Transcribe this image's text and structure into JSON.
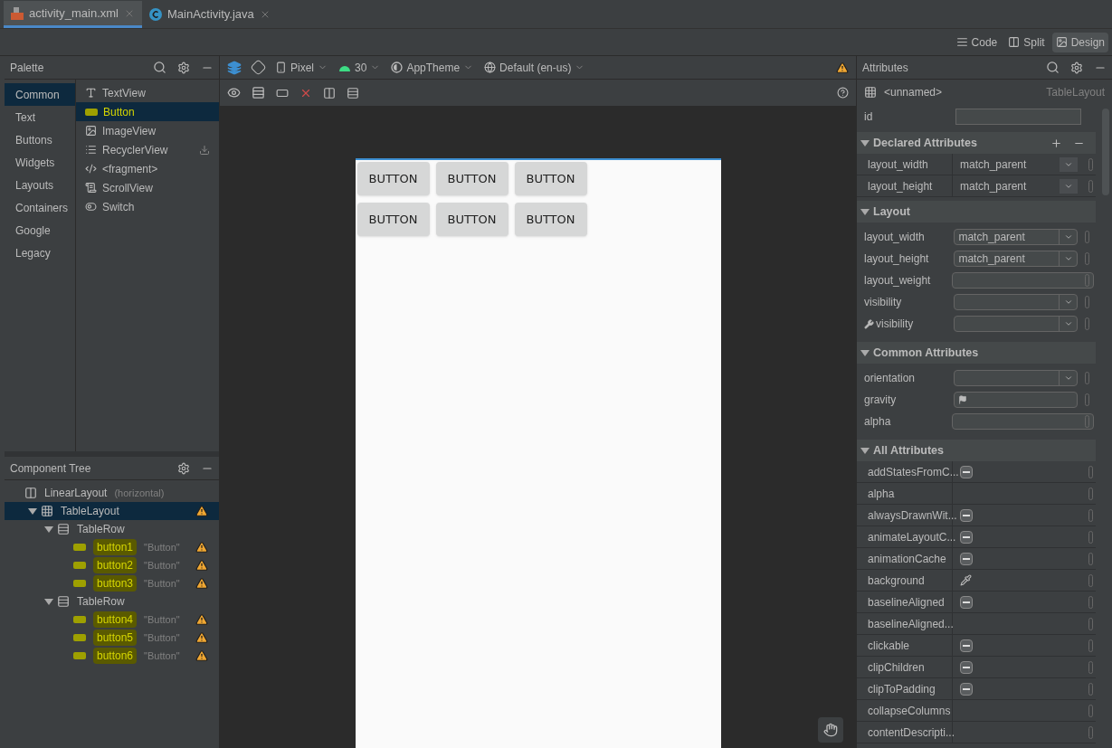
{
  "editor_tabs": [
    {
      "label": "activity_main.xml",
      "kind": "xml",
      "selected": true
    },
    {
      "label": "MainActivity.java",
      "kind": "java",
      "selected": false
    }
  ],
  "view_modes": [
    {
      "label": "Code",
      "kind": "code",
      "selected": false
    },
    {
      "label": "Split",
      "kind": "split",
      "selected": false
    },
    {
      "label": "Design",
      "kind": "design",
      "selected": true
    }
  ],
  "palette": {
    "title": "Palette",
    "categories": [
      {
        "label": "Common",
        "selected": true
      },
      {
        "label": "Text",
        "selected": false
      },
      {
        "label": "Buttons",
        "selected": false
      },
      {
        "label": "Widgets",
        "selected": false
      },
      {
        "label": "Layouts",
        "selected": false
      },
      {
        "label": "Containers",
        "selected": false
      },
      {
        "label": "Google",
        "selected": false
      },
      {
        "label": "Legacy",
        "selected": false
      }
    ],
    "items": [
      {
        "label": "TextView",
        "kind": "text",
        "selected": false,
        "download": false
      },
      {
        "label": "Button",
        "kind": "button",
        "selected": true,
        "download": false
      },
      {
        "label": "ImageView",
        "kind": "image",
        "selected": false,
        "download": false
      },
      {
        "label": "RecyclerView",
        "kind": "list",
        "selected": false,
        "download": true
      },
      {
        "label": "<fragment>",
        "kind": "fragment",
        "selected": false,
        "download": false
      },
      {
        "label": "ScrollView",
        "kind": "scroll",
        "selected": false,
        "download": false
      },
      {
        "label": "Switch",
        "kind": "switch",
        "selected": false,
        "download": false
      }
    ]
  },
  "component_tree": {
    "title": "Component Tree",
    "nodes": [
      {
        "label": "LinearLayout",
        "detail": "(horizontal)",
        "kind": "linear",
        "selected": false,
        "warning": false,
        "highlighted": false,
        "children": [
          {
            "label": "TableLayout",
            "kind": "table",
            "selected": true,
            "expanded": true,
            "warning": true,
            "highlighted": false,
            "children": [
              {
                "label": "TableRow",
                "kind": "row",
                "selected": false,
                "expanded": true,
                "warning": false,
                "highlighted": false,
                "children": [
                  {
                    "label": "button1",
                    "detail": "\"Button\"",
                    "kind": "button",
                    "selected": false,
                    "warning": true,
                    "highlighted": true
                  },
                  {
                    "label": "button2",
                    "detail": "\"Button\"",
                    "kind": "button",
                    "selected": false,
                    "warning": true,
                    "highlighted": true
                  },
                  {
                    "label": "button3",
                    "detail": "\"Button\"",
                    "kind": "button",
                    "selected": false,
                    "warning": true,
                    "highlighted": true
                  }
                ]
              },
              {
                "label": "TableRow",
                "kind": "row",
                "selected": false,
                "expanded": true,
                "warning": false,
                "highlighted": false,
                "children": [
                  {
                    "label": "button4",
                    "detail": "\"Button\"",
                    "kind": "button",
                    "selected": false,
                    "warning": true,
                    "highlighted": true
                  },
                  {
                    "label": "button5",
                    "detail": "\"Button\"",
                    "kind": "button",
                    "selected": false,
                    "warning": true,
                    "highlighted": true
                  },
                  {
                    "label": "button6",
                    "detail": "\"Button\"",
                    "kind": "button",
                    "selected": false,
                    "warning": true,
                    "highlighted": true
                  }
                ]
              }
            ]
          }
        ]
      }
    ]
  },
  "design_toolbar": {
    "dropdowns": [
      {
        "label": "Pixel",
        "kind": "device"
      },
      {
        "label": "30",
        "kind": "api"
      },
      {
        "label": "AppTheme",
        "kind": "theme"
      },
      {
        "label": "Default (en-us)",
        "kind": "locale"
      }
    ],
    "warning": true
  },
  "preview": {
    "rows": [
      [
        "BUTTON",
        "BUTTON",
        "BUTTON"
      ],
      [
        "BUTTON",
        "BUTTON",
        "BUTTON"
      ]
    ]
  },
  "attributes": {
    "title": "Attributes",
    "component_name": "<unnamed>",
    "component_type": "TableLayout",
    "id_label": "id",
    "sections": [
      {
        "title": "Declared Attributes",
        "kind": "table",
        "actions": true,
        "rows": [
          {
            "name": "layout_width",
            "kind": "dropdown",
            "value": "match_parent"
          },
          {
            "name": "layout_height",
            "kind": "dropdown",
            "value": "match_parent"
          }
        ]
      },
      {
        "title": "Layout",
        "kind": "form",
        "actions": false,
        "rows": [
          {
            "name": "layout_width",
            "kind": "dropdown",
            "value": "match_parent"
          },
          {
            "name": "layout_height",
            "kind": "dropdown",
            "value": "match_parent"
          },
          {
            "name": "layout_weight",
            "kind": "input"
          },
          {
            "name": "visibility",
            "kind": "select"
          },
          {
            "name": "visibility",
            "kind": "select",
            "tools": true
          }
        ]
      },
      {
        "title": "Common Attributes",
        "kind": "form",
        "actions": false,
        "rows": [
          {
            "name": "orientation",
            "kind": "select"
          },
          {
            "name": "gravity",
            "kind": "flag"
          },
          {
            "name": "alpha",
            "kind": "input"
          }
        ]
      },
      {
        "title": "All Attributes",
        "kind": "table",
        "actions": false,
        "rows": [
          {
            "name": "addStatesFromC...",
            "kind": "tristate",
            "indeterminate": true
          },
          {
            "name": "alpha",
            "kind": "empty"
          },
          {
            "name": "alwaysDrawnWit...",
            "kind": "tristate",
            "indeterminate": true
          },
          {
            "name": "animateLayoutC...",
            "kind": "tristate",
            "indeterminate": true
          },
          {
            "name": "animationCache",
            "kind": "tristate",
            "indeterminate": true
          },
          {
            "name": "background",
            "kind": "picker"
          },
          {
            "name": "baselineAligned",
            "kind": "tristate",
            "indeterminate": true
          },
          {
            "name": "baselineAligned...",
            "kind": "empty"
          },
          {
            "name": "clickable",
            "kind": "tristate",
            "indeterminate": true
          },
          {
            "name": "clipChildren",
            "kind": "tristate",
            "indeterminate": true
          },
          {
            "name": "clipToPadding",
            "kind": "tristate",
            "indeterminate": true
          },
          {
            "name": "collapseColumns",
            "kind": "empty"
          },
          {
            "name": "contentDescripti...",
            "kind": "empty"
          }
        ]
      }
    ]
  }
}
